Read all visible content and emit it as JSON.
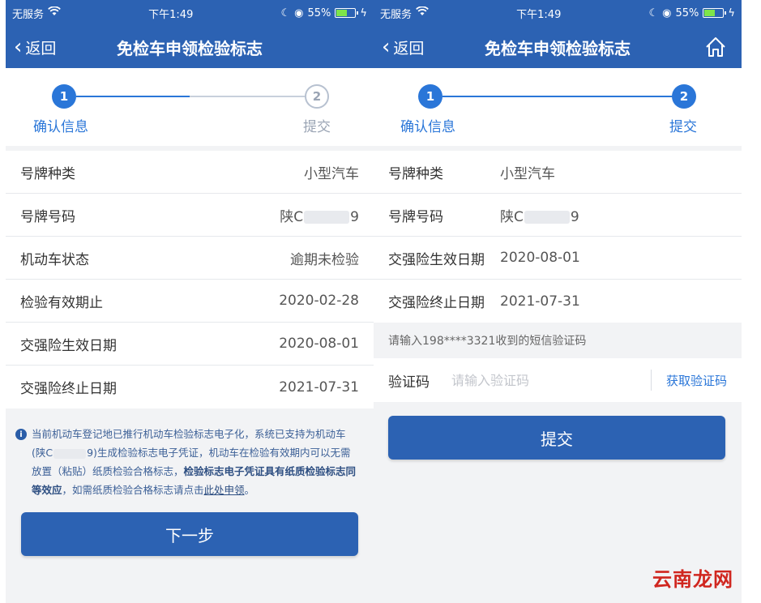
{
  "left": {
    "status": {
      "carrier": "无服务",
      "time": "下午1:49",
      "battery": "55%"
    },
    "nav": {
      "back": "返回",
      "title": "免检车申领检验标志"
    },
    "steps": [
      {
        "num": "1",
        "label": "确认信息"
      },
      {
        "num": "2",
        "label": "提交"
      }
    ],
    "rows": [
      {
        "label": "号牌种类",
        "value": "小型汽车"
      },
      {
        "label": "号牌号码",
        "value_prefix": "陕C",
        "value_suffix": "9"
      },
      {
        "label": "机动车状态",
        "value": "逾期未检验"
      },
      {
        "label": "检验有效期止",
        "value": "2020-02-28"
      },
      {
        "label": "交强险生效日期",
        "value": "2020-08-01"
      },
      {
        "label": "交强险终止日期",
        "value": "2021-07-31"
      }
    ],
    "notice": {
      "part1": "当前机动车登记地已推行机动车检验标志电子化，系统已支持为机动车(陕C",
      "part2": "9)生成检验标志电子凭证，机动车在检验有效期内可以无需放置（粘贴）纸质检验合格标志，",
      "bold": "检验标志电子凭证具有纸质检验标志同等效应",
      "part3": "，如需纸质检验合格标志请点击",
      "link": "此处申领",
      "end": "。"
    },
    "button": "下一步"
  },
  "right": {
    "status": {
      "carrier": "无服务",
      "time": "下午1:49",
      "battery": "55%"
    },
    "nav": {
      "back": "返回",
      "title": "免检车申领检验标志",
      "home_icon": "home-icon"
    },
    "steps": [
      {
        "num": "1",
        "label": "确认信息"
      },
      {
        "num": "2",
        "label": "提交"
      }
    ],
    "rows": [
      {
        "label": "号牌种类",
        "value": "小型汽车"
      },
      {
        "label": "号牌号码",
        "value_prefix": "陕C",
        "value_suffix": "9"
      },
      {
        "label": "交强险生效日期",
        "value": "2020-08-01"
      },
      {
        "label": "交强险终止日期",
        "value": "2021-07-31"
      }
    ],
    "sms_tip": "请输入198****3321收到的短信验证码",
    "code": {
      "label": "验证码",
      "placeholder": "请输入验证码",
      "get_code": "获取验证码"
    },
    "button": "提交"
  },
  "watermark": "云南龙网",
  "colors": {
    "primary": "#2c62b3",
    "accent": "#2a76d8",
    "battery": "#7ee44a"
  }
}
